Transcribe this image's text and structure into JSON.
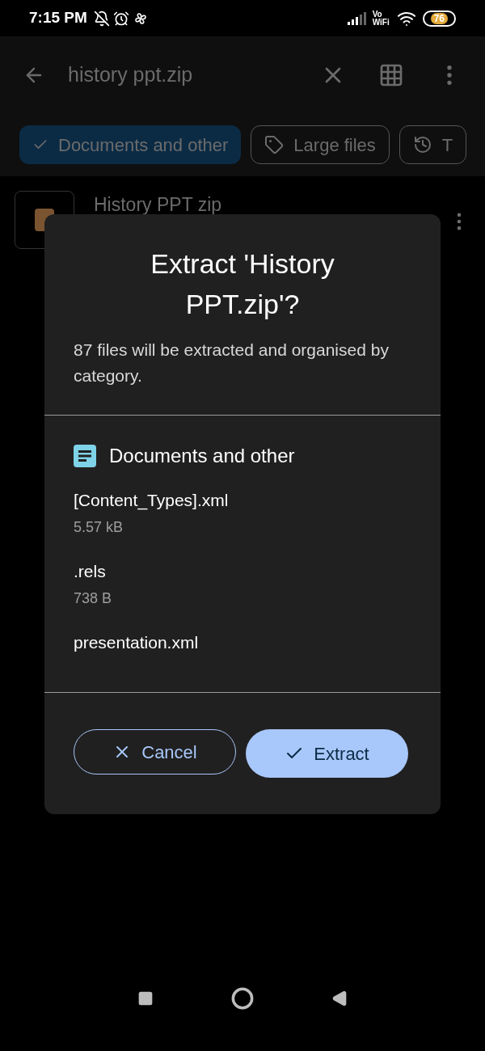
{
  "status_bar": {
    "time": "7:15 PM",
    "network_label": "Vo WiFi",
    "battery": "76"
  },
  "app_bar": {
    "search_value": "history ppt.zip"
  },
  "chips": [
    {
      "label": "Documents and other",
      "selected": true,
      "kind": "check"
    },
    {
      "label": "Large files",
      "selected": false,
      "kind": "tag"
    },
    {
      "label": "T",
      "selected": false,
      "kind": "history"
    }
  ],
  "results": [
    {
      "name": "History PPT zip"
    }
  ],
  "dialog": {
    "title": "Extract 'History PPT.zip'?",
    "message": "87 files will be extracted and organised by category.",
    "section": "Documents and other",
    "files": [
      {
        "name": "[Content_Types].xml",
        "size": "5.57 kB"
      },
      {
        "name": ".rels",
        "size": "738 B"
      },
      {
        "name": "presentation.xml"
      }
    ],
    "cancel": "Cancel",
    "confirm": "Extract"
  }
}
